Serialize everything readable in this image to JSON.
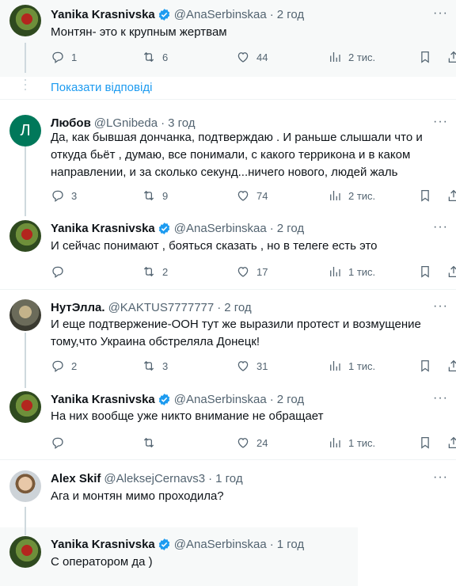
{
  "show_replies_label": "Показати відповіді",
  "tweets": [
    {
      "name": "Yanika Krasnivska",
      "verified": true,
      "handle": "@AnaSerbinskaa",
      "time": "2 год",
      "text": "Монтян- это к крупным жертвам",
      "replies": "1",
      "retweets": "6",
      "likes": "44",
      "views": "2 тис."
    },
    {
      "avatar_letter": "Л",
      "name": "Любов",
      "verified": false,
      "handle": "@LGnibeda",
      "time": "3 год",
      "text": "Да, как бывшая дончанка, подтверждаю . И раньше слышали что и откуда бьёт , думаю, все понимали, с какого терриконa и в каком направлении, и за сколько секунд...ничего нового, людей жаль",
      "replies": "3",
      "retweets": "9",
      "likes": "74",
      "views": "2 тис."
    },
    {
      "name": "Yanika Krasnivska",
      "verified": true,
      "handle": "@AnaSerbinskaa",
      "time": "2 год",
      "text": "И сейчас понимают , бояться сказать , но в телеге есть это",
      "replies": "",
      "retweets": "2",
      "likes": "17",
      "views": "1 тис."
    },
    {
      "name": "НутЭлла.",
      "verified": false,
      "handle": "@KAKTUS7777777",
      "time": "2 год",
      "text": "И еще подтвержение-ООН тут же выразили протест и возмущение тому,что Украина обстреляла Донецк!",
      "replies": "2",
      "retweets": "3",
      "likes": "31",
      "views": "1 тис."
    },
    {
      "name": "Yanika Krasnivska",
      "verified": true,
      "handle": "@AnaSerbinskaa",
      "time": "2 год",
      "text": "На них вообще уже никто внимание не обращает",
      "replies": "",
      "retweets": "",
      "likes": "24",
      "views": "1 тис."
    },
    {
      "name": "Alex Skif",
      "verified": false,
      "handle": "@AleksejCernavs3",
      "time": "1 год",
      "text": "Ага и монтян мимо проходила?"
    },
    {
      "name": "Yanika Krasnivska",
      "verified": true,
      "handle": "@AnaSerbinskaa",
      "time": "1 год",
      "text": "С оператором да )"
    }
  ],
  "colors": {
    "accent": "#1d9bf0",
    "muted": "#536471",
    "text": "#0f1419",
    "line": "#cfd9de"
  },
  "icons": [
    "reply-icon",
    "retweet-icon",
    "like-icon",
    "views-icon",
    "bookmark-icon",
    "share-icon",
    "verified-icon",
    "more-icon"
  ]
}
